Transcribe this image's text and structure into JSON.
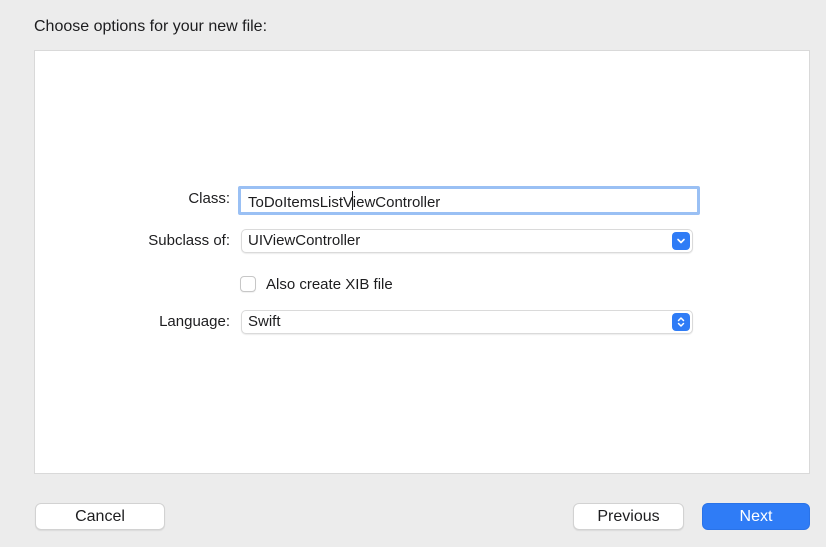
{
  "header": {
    "title": "Choose options for your new file:"
  },
  "form": {
    "class_label": "Class:",
    "class_value": "ToDoItemsListViewController",
    "subclass_label": "Subclass of:",
    "subclass_value": "UIViewController",
    "xib_label": "Also create XIB file",
    "xib_checked": false,
    "language_label": "Language:",
    "language_value": "Swift"
  },
  "footer": {
    "cancel_label": "Cancel",
    "previous_label": "Previous",
    "next_label": "Next"
  },
  "icons": {
    "subclass_dropdown": "chevron-down-icon",
    "language_dropdown": "up-down-chevron-icon"
  },
  "colors": {
    "accent": "#2f7cf6",
    "focus_ring": "#9ac0f4",
    "background": "#ececec",
    "panel": "#ffffff"
  }
}
